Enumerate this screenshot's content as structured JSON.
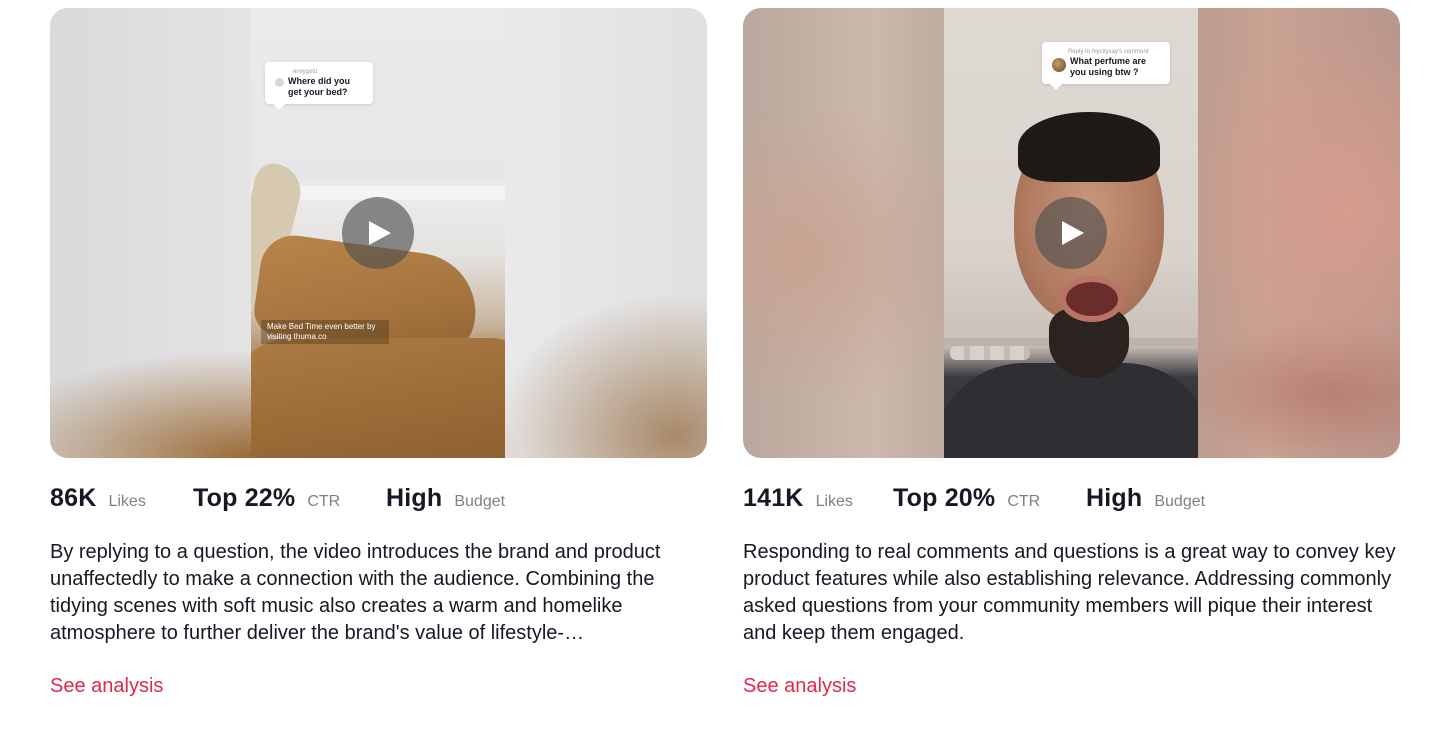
{
  "cards": [
    {
      "comment": {
        "user": "envygold",
        "text": "Where did you get your bed?"
      },
      "caption": "Make Bed Time even better by visiting thuma.co",
      "stats": {
        "likes_value": "86K",
        "likes_label": "Likes",
        "ctr_value": "Top 22%",
        "ctr_label": "CTR",
        "budget_value": "High",
        "budget_label": "Budget"
      },
      "description": "By replying to a question, the video introduces the brand and product unaffectedly to make a connection with the audience. Combining the tidying scenes with soft music also creates a warm and homelike atmosphere to further deliver the brand's value of lifestyle-…",
      "link_label": "See analysis"
    },
    {
      "comment": {
        "user": "Reply to mycityxay's comment",
        "text": "What perfume are you using btw ?"
      },
      "stats": {
        "likes_value": "141K",
        "likes_label": "Likes",
        "ctr_value": "Top 20%",
        "ctr_label": "CTR",
        "budget_value": "High",
        "budget_label": "Budget"
      },
      "description": "Responding to real comments and questions is a great way to convey key product features while also establishing relevance. Addressing commonly asked questions from your community members will pique their interest and keep them engaged.",
      "link_label": "See analysis"
    }
  ],
  "icons": {
    "play": "play-icon"
  }
}
